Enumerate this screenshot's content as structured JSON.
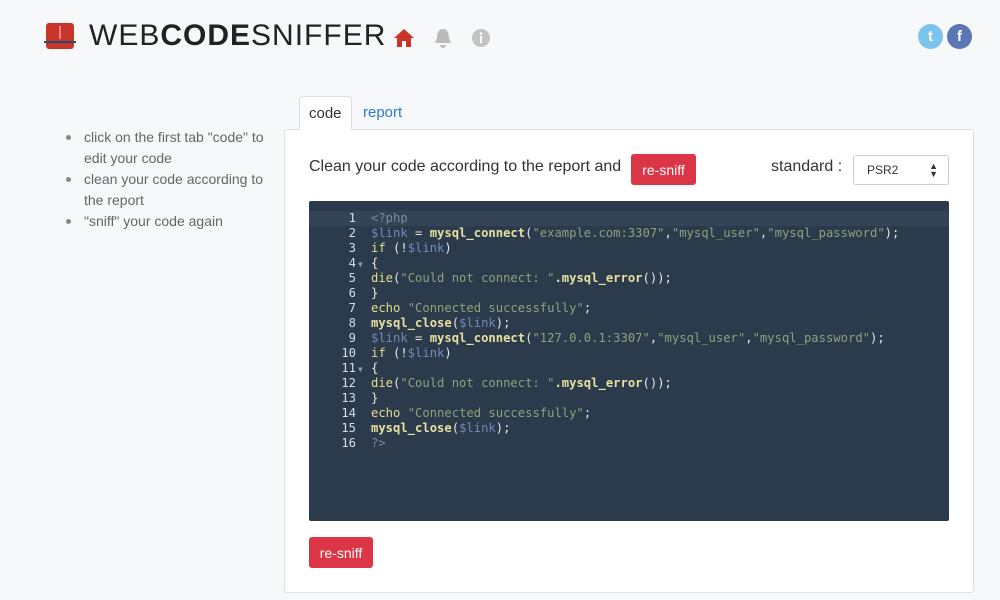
{
  "brand": {
    "part1": "WEB",
    "part2": "CODE",
    "part3": "SNIFFER"
  },
  "icons": {
    "home": "home-icon",
    "bell": "bell-icon",
    "info": "info-icon",
    "twitter": "twitter-icon",
    "facebook": "facebook-icon"
  },
  "social": {
    "twitter": "t",
    "facebook": "f"
  },
  "tips": [
    "click on the first tab \"code\" to edit your code",
    "clean your code according to the report",
    "\"sniff\" your code again"
  ],
  "tabs": {
    "code": "code",
    "report": "report"
  },
  "instruction": "Clean your code according to the report and",
  "resniff_label": "re-sniff",
  "standard": {
    "label": "standard :",
    "value": "PSR2"
  },
  "colors": {
    "accent": "#dc3545",
    "editor_bg": "#2c3b4c",
    "link": "#2a7ad6"
  },
  "code": [
    [
      [
        "tag",
        "<?php"
      ]
    ],
    [
      [
        "var",
        "$link"
      ],
      [
        "op",
        " = "
      ],
      [
        "fn",
        "mysql_connect"
      ],
      [
        "p",
        "("
      ],
      [
        "str",
        "\"example.com:3307\""
      ],
      [
        "p",
        ","
      ],
      [
        "str",
        "\"mysql_user\""
      ],
      [
        "p",
        ","
      ],
      [
        "str",
        "\"mysql_password\""
      ],
      [
        "p",
        ");"
      ]
    ],
    [
      [
        "kw",
        "if"
      ],
      [
        "p",
        " (!"
      ],
      [
        "var",
        "$link"
      ],
      [
        "p",
        ")"
      ]
    ],
    [
      [
        "p",
        "{"
      ]
    ],
    [
      [
        "kw",
        "die"
      ],
      [
        "p",
        "("
      ],
      [
        "str",
        "\"Could not connect: \""
      ],
      [
        "fn",
        ".mysql_error"
      ],
      [
        "p",
        "());"
      ]
    ],
    [
      [
        "p",
        "}"
      ]
    ],
    [
      [
        "kw",
        "echo"
      ],
      [
        "p",
        " "
      ],
      [
        "str",
        "\"Connected successfully\""
      ],
      [
        "p",
        ";"
      ]
    ],
    [
      [
        "fn",
        "mysql_close"
      ],
      [
        "p",
        "("
      ],
      [
        "var",
        "$link"
      ],
      [
        "p",
        ");"
      ]
    ],
    [
      [
        "var",
        "$link"
      ],
      [
        "op",
        " = "
      ],
      [
        "fn",
        "mysql_connect"
      ],
      [
        "p",
        "("
      ],
      [
        "str",
        "\"127.0.0.1:3307\""
      ],
      [
        "p",
        ","
      ],
      [
        "str",
        "\"mysql_user\""
      ],
      [
        "p",
        ","
      ],
      [
        "str",
        "\"mysql_password\""
      ],
      [
        "p",
        ");"
      ]
    ],
    [
      [
        "kw",
        "if"
      ],
      [
        "p",
        " (!"
      ],
      [
        "var",
        "$link"
      ],
      [
        "p",
        ")"
      ]
    ],
    [
      [
        "p",
        "{"
      ]
    ],
    [
      [
        "kw",
        "die"
      ],
      [
        "p",
        "("
      ],
      [
        "str",
        "\"Could not connect: \""
      ],
      [
        "fn",
        ".mysql_error"
      ],
      [
        "p",
        "());"
      ]
    ],
    [
      [
        "p",
        "}"
      ]
    ],
    [
      [
        "kw",
        "echo"
      ],
      [
        "p",
        " "
      ],
      [
        "str",
        "\"Connected successfully\""
      ],
      [
        "p",
        ";"
      ]
    ],
    [
      [
        "fn",
        "mysql_close"
      ],
      [
        "p",
        "("
      ],
      [
        "var",
        "$link"
      ],
      [
        "p",
        ");"
      ]
    ],
    [
      [
        "tag",
        "?>"
      ]
    ]
  ],
  "fold_lines": [
    4,
    11
  ]
}
